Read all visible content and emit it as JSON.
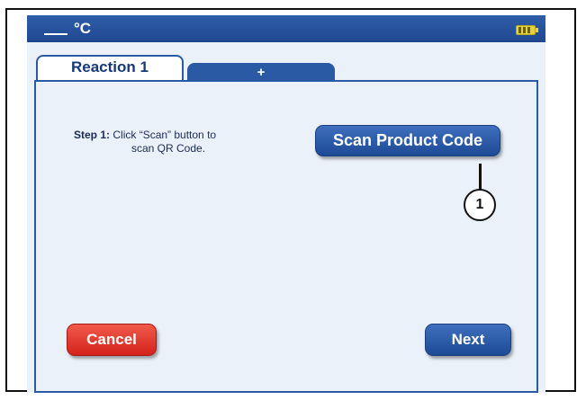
{
  "status_bar": {
    "temperature_unit": "°C",
    "battery_icon": "battery-icon"
  },
  "tabs": [
    {
      "label": "Reaction 1",
      "active": true
    },
    {
      "label": "+",
      "active": false
    }
  ],
  "main": {
    "step_label": "Step 1:",
    "step_text_line1": "Click “Scan” button to",
    "step_text_line2": "scan QR Code.",
    "scan_button": "Scan Product Code",
    "cancel_button": "Cancel",
    "next_button": "Next"
  },
  "callout": {
    "number": "1"
  },
  "colors": {
    "accent_blue": "#2a5aa3",
    "cancel_red": "#d4221b",
    "panel_bg": "#eaf1f8",
    "battery": "#e6d23a"
  }
}
